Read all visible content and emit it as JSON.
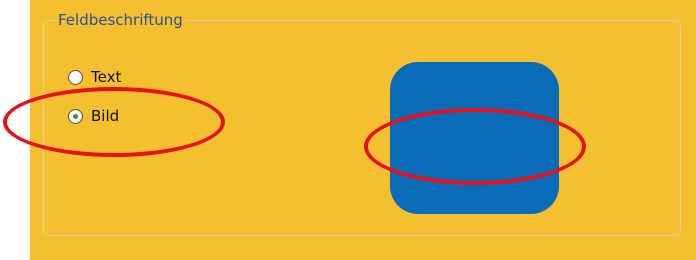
{
  "fieldset": {
    "legend": "Feldbeschriftung"
  },
  "options": [
    {
      "label": "Text",
      "checked": false
    },
    {
      "label": "Bild",
      "checked": true
    }
  ],
  "colors": {
    "panel_background": "#f5c030",
    "legend_text": "#2a4f9e",
    "preview_fill": "#0a6bb8",
    "annotation": "#e8101a",
    "radio_dot": "#2e9c2e"
  }
}
